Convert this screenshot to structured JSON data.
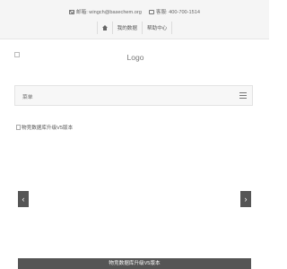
{
  "header": {
    "email_label": "邮箱: wingch@basechem.org",
    "phone_label": "客服: 400-700-1514",
    "nav": [
      {
        "label": "我的数据"
      },
      {
        "label": "帮助中心"
      }
    ]
  },
  "logo": {
    "alt": "Logo"
  },
  "menu": {
    "label": "菜单"
  },
  "carousel": {
    "slide_alt": "物竞数据库升级V5版本",
    "prev_symbol": "‹",
    "next_symbol": "›",
    "caption": "物竞数据库升级V5版本"
  }
}
